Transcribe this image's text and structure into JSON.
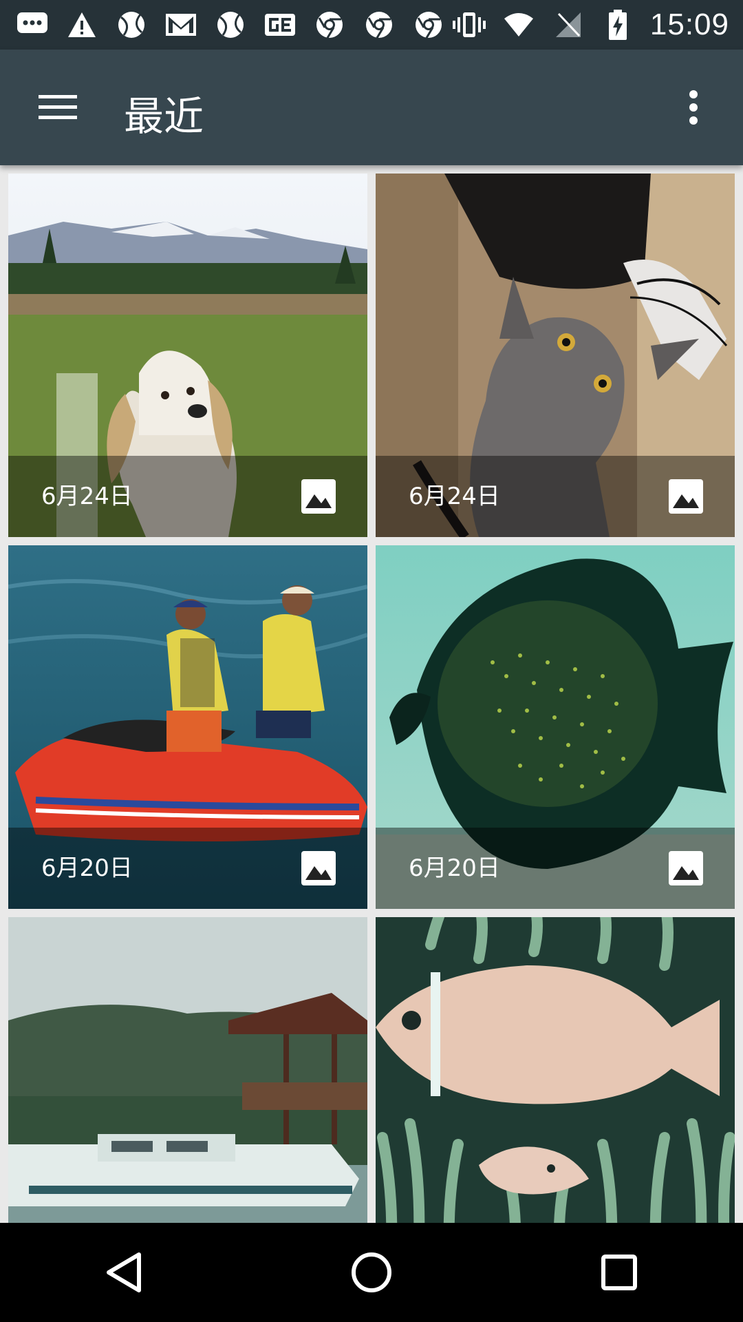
{
  "status_bar": {
    "time": "15:09",
    "icons": [
      "chat-icon",
      "alert-icon",
      "ball-icon",
      "gmail-icon",
      "ball-icon",
      "ge-icon",
      "chrome-icon",
      "chrome-icon",
      "chrome-icon",
      "vibrate-icon",
      "wifi-icon",
      "no-signal-icon",
      "battery-charging-icon"
    ]
  },
  "appbar": {
    "title": "最近",
    "menu_icon": "hamburger-menu-icon",
    "overflow_icon": "more-vert-icon"
  },
  "items": [
    {
      "date": "6月24日",
      "subject": "dog"
    },
    {
      "date": "6月24日",
      "subject": "cat"
    },
    {
      "date": "6月20日",
      "subject": "jetski"
    },
    {
      "date": "6月20日",
      "subject": "angelfish"
    },
    {
      "date": "",
      "subject": "boat"
    },
    {
      "date": "",
      "subject": "clownfish"
    }
  ],
  "navbar": {
    "back": "back-icon",
    "home": "home-icon",
    "recents": "recents-icon"
  },
  "colors": {
    "status_bar": "#263238",
    "app_bar": "#37474f",
    "background": "#e9e9e9"
  }
}
